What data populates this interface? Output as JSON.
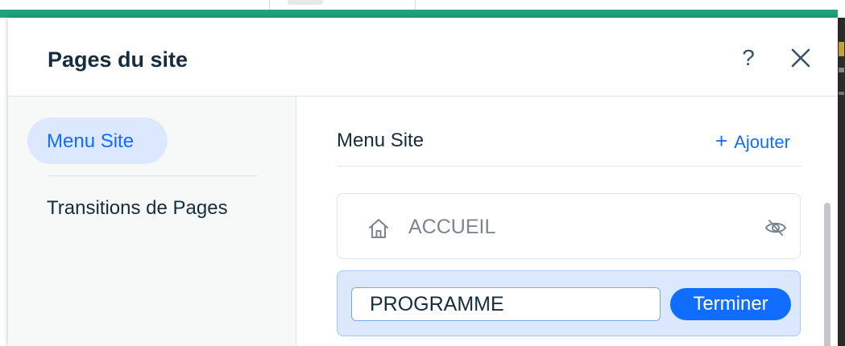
{
  "panel": {
    "title": "Pages du site",
    "help_label": "?",
    "close_icon": "close-icon",
    "accent_color": "#1ea37a"
  },
  "sidebar": {
    "items": [
      {
        "label": "Menu Site",
        "active": true
      },
      {
        "label": "Transitions de Pages",
        "active": false
      }
    ]
  },
  "main": {
    "title": "Menu Site",
    "add_label": "Ajouter",
    "add_icon": "plus-icon",
    "pages": [
      {
        "label": "ACCUEIL",
        "icon": "home-icon",
        "status_icon": "hidden-eye-icon"
      }
    ],
    "editing": {
      "value": "PROGRAMME",
      "done_label": "Terminer"
    }
  },
  "colors": {
    "primary": "#116dff",
    "active_bg": "#dbe8fd",
    "text": "#162d3d"
  }
}
